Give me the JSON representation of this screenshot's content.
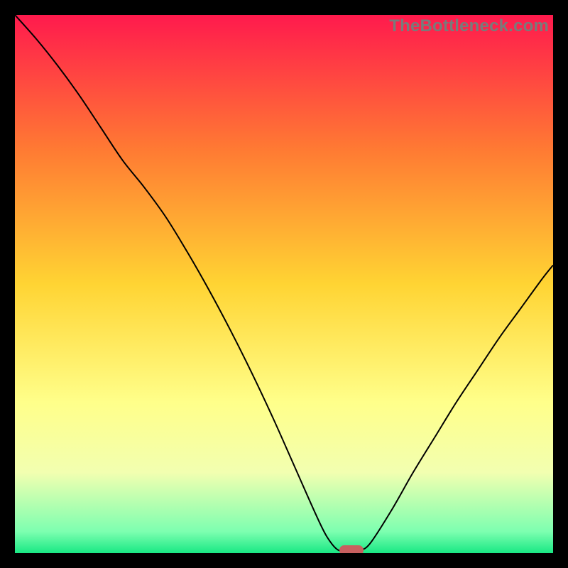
{
  "watermark": "TheBottleneck.com",
  "chart_data": {
    "type": "line",
    "title": "",
    "xlabel": "",
    "ylabel": "",
    "xlim": [
      0,
      100
    ],
    "ylim": [
      0,
      100
    ],
    "grid": false,
    "legend": false,
    "background": {
      "type": "vertical-gradient",
      "description": "red → orange → yellow → pale-yellow → green from top to bottom",
      "stops": [
        {
          "pct": 0,
          "color": "#ff1a4d"
        },
        {
          "pct": 25,
          "color": "#ff7a33"
        },
        {
          "pct": 50,
          "color": "#ffd433"
        },
        {
          "pct": 72,
          "color": "#ffff8a"
        },
        {
          "pct": 85,
          "color": "#f2ffb0"
        },
        {
          "pct": 96,
          "color": "#7dffb0"
        },
        {
          "pct": 100,
          "color": "#19e884"
        }
      ]
    },
    "series": [
      {
        "name": "bottleneck-curve",
        "color": "#000000",
        "stroke_width": 2,
        "x": [
          0,
          4,
          8,
          12,
          16,
          20,
          24,
          28,
          32,
          36,
          40,
          44,
          48,
          52,
          56,
          58,
          60,
          62,
          64,
          66,
          70,
          74,
          78,
          82,
          86,
          90,
          94,
          98,
          100
        ],
        "values": [
          100,
          95.5,
          90.5,
          85,
          79,
          73,
          68,
          62.5,
          56,
          49,
          41.5,
          33.5,
          25,
          16,
          7,
          3,
          0.6,
          0.5,
          0.5,
          1.8,
          8,
          15,
          21.5,
          28,
          34,
          40,
          45.5,
          51,
          53.5
        ]
      }
    ],
    "annotations": [
      {
        "type": "rounded-rect",
        "name": "optimal-marker",
        "color": "#c8605f",
        "x": 62.5,
        "y": 0.5,
        "width_pct": 4.5,
        "height_pct": 1.8
      }
    ]
  }
}
